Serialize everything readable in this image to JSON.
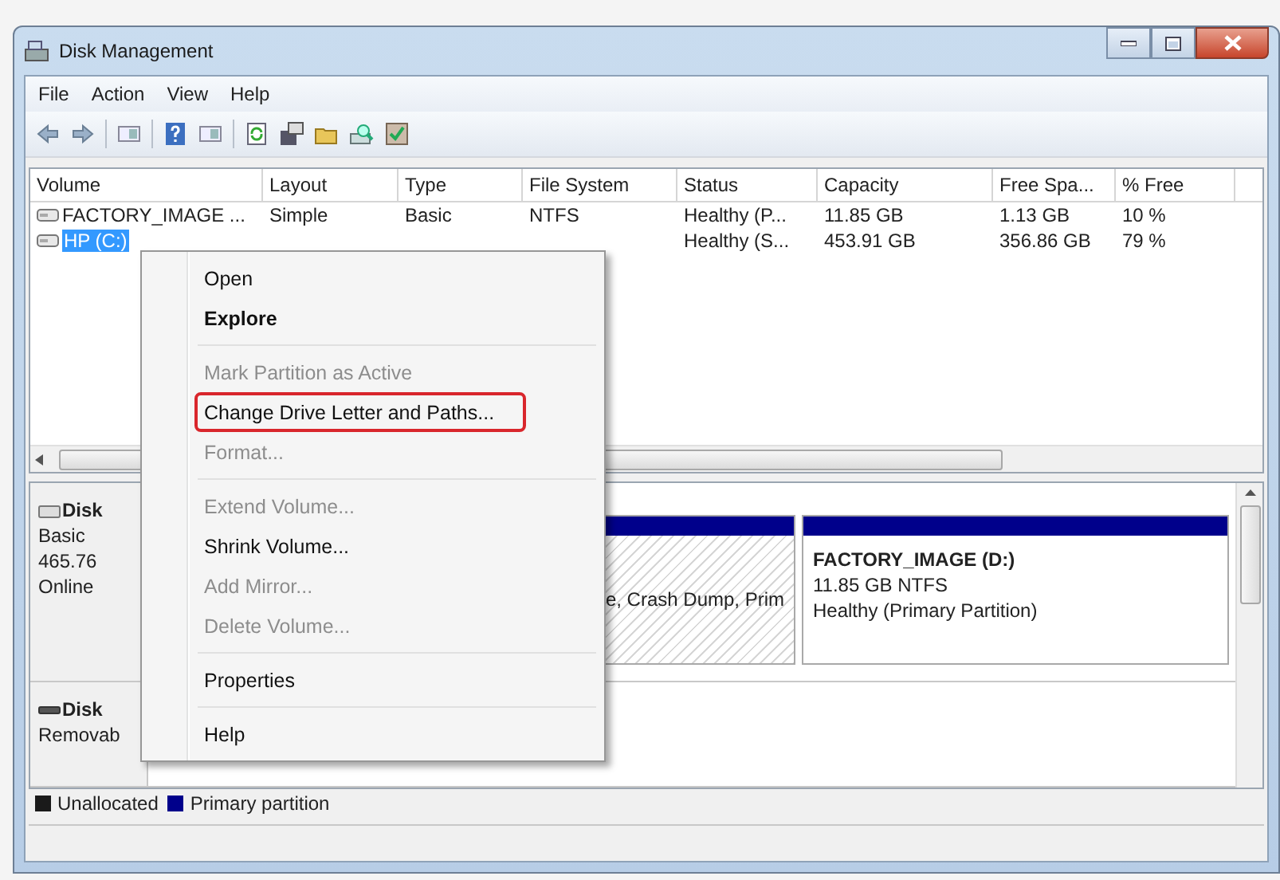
{
  "window": {
    "title": "Disk Management"
  },
  "menu_bar": [
    "File",
    "Action",
    "View",
    "Help"
  ],
  "volume_table": {
    "columns": [
      "Volume",
      "Layout",
      "Type",
      "File System",
      "Status",
      "Capacity",
      "Free Spa...",
      "% Free"
    ],
    "rows": [
      {
        "cells": [
          "FACTORY_IMAGE ...",
          "Simple",
          "Basic",
          "NTFS",
          "Healthy (P...",
          "11.85 GB",
          "1.13 GB",
          "10 %"
        ],
        "selected": false
      },
      {
        "cells": [
          "HP (C:)",
          null,
          null,
          null,
          "Healthy (S...",
          "453.91 GB",
          "356.86 GB",
          "79 %"
        ],
        "selected": true
      }
    ]
  },
  "disks": [
    {
      "kind": "hard_disk",
      "name": "Disk",
      "lines": [
        "Basic",
        "465.76",
        "Online"
      ],
      "partitions": [
        {
          "lines": [
            "e, Crash Dump, Prim"
          ],
          "selected": true
        },
        {
          "title": "FACTORY_IMAGE  (D:)",
          "lines": [
            "11.85 GB NTFS",
            "Healthy (Primary Partition)"
          ],
          "selected": false
        }
      ]
    },
    {
      "kind": "removable",
      "name": "Disk",
      "lines": [
        "Removab"
      ]
    }
  ],
  "legend": [
    {
      "label": "Unallocated",
      "color": "#1a1a1a"
    },
    {
      "label": "Primary partition",
      "color": "#00008b"
    }
  ],
  "context_menu": {
    "items": [
      {
        "kind": "item",
        "label": "Open",
        "disabled": false,
        "default": false,
        "highlighted": false
      },
      {
        "kind": "item",
        "label": "Explore",
        "disabled": false,
        "default": true,
        "highlighted": false
      },
      {
        "kind": "separator"
      },
      {
        "kind": "item",
        "label": "Mark Partition as Active",
        "disabled": true,
        "default": false,
        "highlighted": false
      },
      {
        "kind": "item",
        "label": "Change Drive Letter and Paths...",
        "disabled": false,
        "default": false,
        "highlighted": true
      },
      {
        "kind": "item",
        "label": "Format...",
        "disabled": true,
        "default": false,
        "highlighted": false
      },
      {
        "kind": "separator"
      },
      {
        "kind": "item",
        "label": "Extend Volume...",
        "disabled": true,
        "default": false,
        "highlighted": false
      },
      {
        "kind": "item",
        "label": "Shrink Volume...",
        "disabled": false,
        "default": false,
        "highlighted": false
      },
      {
        "kind": "item",
        "label": "Add Mirror...",
        "disabled": true,
        "default": false,
        "highlighted": false
      },
      {
        "kind": "item",
        "label": "Delete Volume...",
        "disabled": true,
        "default": false,
        "highlighted": false
      },
      {
        "kind": "separator"
      },
      {
        "kind": "item",
        "label": "Properties",
        "disabled": false,
        "default": false,
        "highlighted": false
      },
      {
        "kind": "separator"
      },
      {
        "kind": "item",
        "label": "Help",
        "disabled": false,
        "default": false,
        "highlighted": false
      }
    ]
  }
}
